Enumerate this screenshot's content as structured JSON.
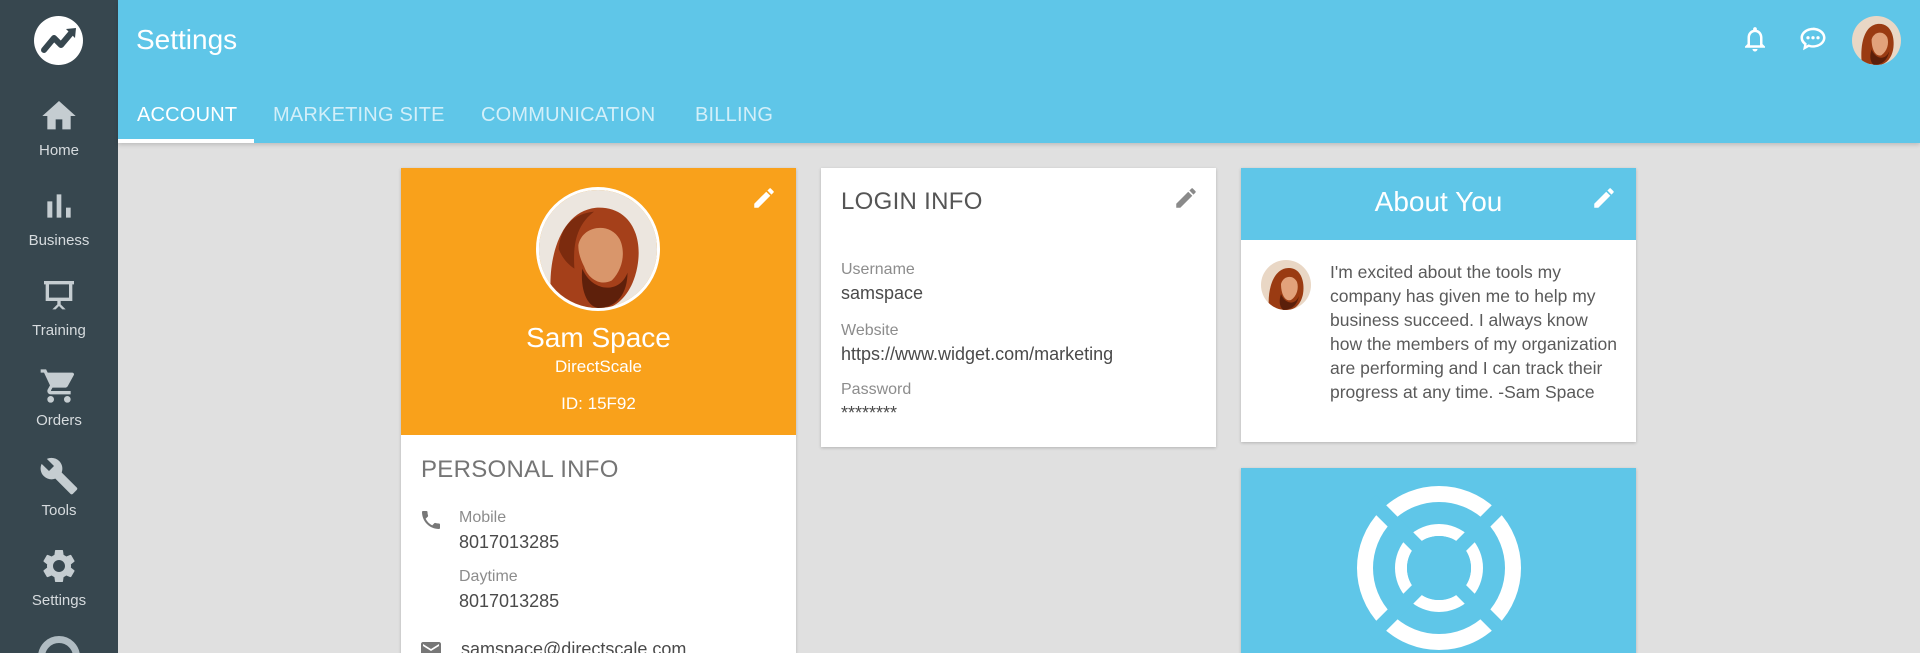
{
  "app": {
    "title": "Settings"
  },
  "sidebar": {
    "items": [
      {
        "label": "Home",
        "icon": "home-icon"
      },
      {
        "label": "Business",
        "icon": "bar-chart-icon"
      },
      {
        "label": "Training",
        "icon": "presentation-icon"
      },
      {
        "label": "Orders",
        "icon": "cart-icon"
      },
      {
        "label": "Tools",
        "icon": "wrench-icon"
      },
      {
        "label": "Settings",
        "icon": "gear-icon"
      }
    ]
  },
  "header": {
    "icons": [
      "bell-icon",
      "chat-icon",
      "user-avatar"
    ]
  },
  "tabs": [
    {
      "label": "ACCOUNT",
      "active": true
    },
    {
      "label": "MARKETING SITE",
      "active": false
    },
    {
      "label": "COMMUNICATION",
      "active": false
    },
    {
      "label": "BILLING",
      "active": false
    }
  ],
  "profile": {
    "name": "Sam Space",
    "company": "DirectScale",
    "id": "ID: 15F92"
  },
  "personal_info": {
    "title": "PERSONAL INFO",
    "mobile_label": "Mobile",
    "mobile": "8017013285",
    "daytime_label": "Daytime",
    "daytime": "8017013285",
    "email": "samspace@directscale.com"
  },
  "login_info": {
    "title": "LOGIN INFO",
    "username_label": "Username",
    "username": "samspace",
    "website_label": "Website",
    "website": "https://www.widget.com/marketing",
    "password_label": "Password",
    "password": "********"
  },
  "about": {
    "title": "About You",
    "text": "I'm excited about the tools my company has given me to help my business succeed. I always know how the members of my organization are performing and I can track their progress at any time. -Sam Space"
  },
  "colors": {
    "sidebar": "#37474f",
    "header": "#5fc6e8",
    "profile_accent": "#f9a11b",
    "background": "#e0e0e0"
  }
}
